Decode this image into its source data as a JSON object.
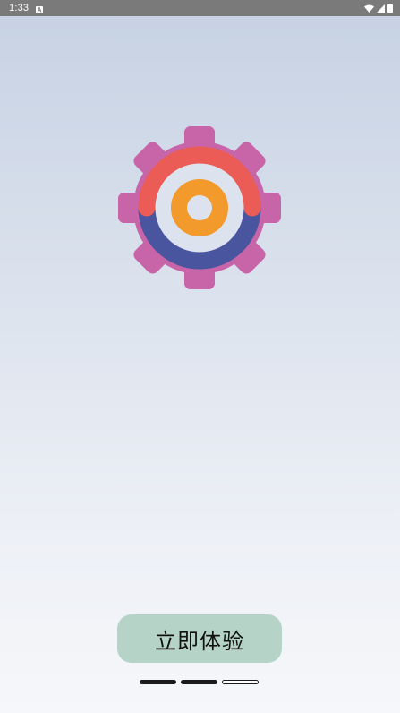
{
  "status_bar": {
    "time": "1:33",
    "icons": [
      "notification-a-icon",
      "wifi-icon",
      "cellular-signal-icon",
      "battery-icon"
    ]
  },
  "logo": {
    "icon": "gear-target-icon",
    "colors": {
      "gear": "#c765a8",
      "upper_ring": "#ea5c55",
      "lower_ring": "#4a55a0",
      "inner_ring": "#f39a2c",
      "center": "#dde3ee"
    }
  },
  "cta_button": {
    "label": "立即体验",
    "color": "#b6d3c7"
  },
  "page_indicator": {
    "total": 3,
    "current": 3,
    "dots": [
      "filled",
      "filled",
      "empty"
    ]
  }
}
